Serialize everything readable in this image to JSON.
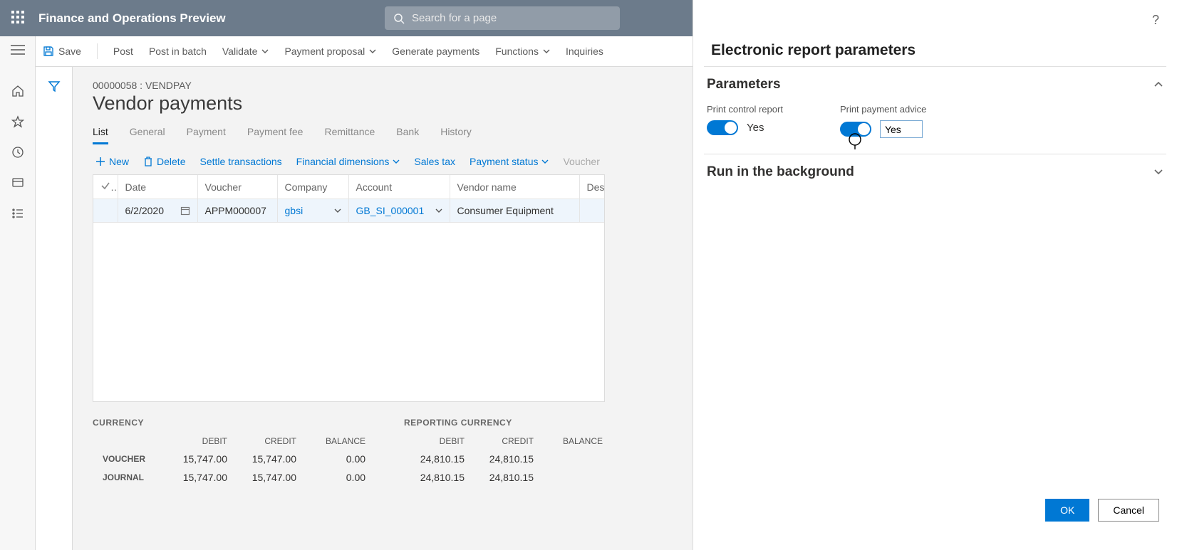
{
  "app": {
    "title": "Finance and Operations Preview"
  },
  "search": {
    "placeholder": "Search for a page"
  },
  "toolbar": {
    "save": "Save",
    "post": "Post",
    "post_batch": "Post in batch",
    "validate": "Validate",
    "payment_proposal": "Payment proposal",
    "generate_payments": "Generate payments",
    "functions": "Functions",
    "inquiries": "Inquiries"
  },
  "page": {
    "breadcrumb": "00000058 : VENDPAY",
    "title": "Vendor payments"
  },
  "tabs": [
    "List",
    "General",
    "Payment",
    "Payment fee",
    "Remittance",
    "Bank",
    "History"
  ],
  "active_tab": "List",
  "gridbar": {
    "new": "New",
    "delete": "Delete",
    "settle": "Settle transactions",
    "fin_dim": "Financial dimensions",
    "sales_tax": "Sales tax",
    "pay_status": "Payment status",
    "voucher": "Voucher"
  },
  "grid": {
    "columns": [
      "Date",
      "Voucher",
      "Company",
      "Account",
      "Vendor name",
      "Description"
    ],
    "rows": [
      {
        "date": "6/2/2020",
        "voucher": "APPM000007",
        "company": "gbsi",
        "account": "GB_SI_000001",
        "vendor": "Consumer Equipment",
        "desc": ""
      }
    ]
  },
  "totals": {
    "currency_label": "CURRENCY",
    "reporting_label": "REPORTING CURRENCY",
    "headers": {
      "debit": "DEBIT",
      "credit": "CREDIT",
      "balance": "BALANCE"
    },
    "rows_labels": {
      "voucher": "VOUCHER",
      "journal": "JOURNAL"
    },
    "currency": {
      "voucher": {
        "debit": "15,747.00",
        "credit": "15,747.00",
        "balance": "0.00"
      },
      "journal": {
        "debit": "15,747.00",
        "credit": "15,747.00",
        "balance": "0.00"
      }
    },
    "reporting": {
      "voucher": {
        "debit": "24,810.15",
        "credit": "24,810.15",
        "balance": ""
      },
      "journal": {
        "debit": "24,810.15",
        "credit": "24,810.15",
        "balance": ""
      }
    }
  },
  "panel": {
    "title": "Electronic report parameters",
    "sections": {
      "parameters": "Parameters",
      "run_bg": "Run in the background"
    },
    "fields": {
      "print_control": {
        "label": "Print control report",
        "value": "Yes"
      },
      "print_advice": {
        "label": "Print payment advice",
        "value": "Yes"
      }
    },
    "buttons": {
      "ok": "OK",
      "cancel": "Cancel"
    }
  }
}
